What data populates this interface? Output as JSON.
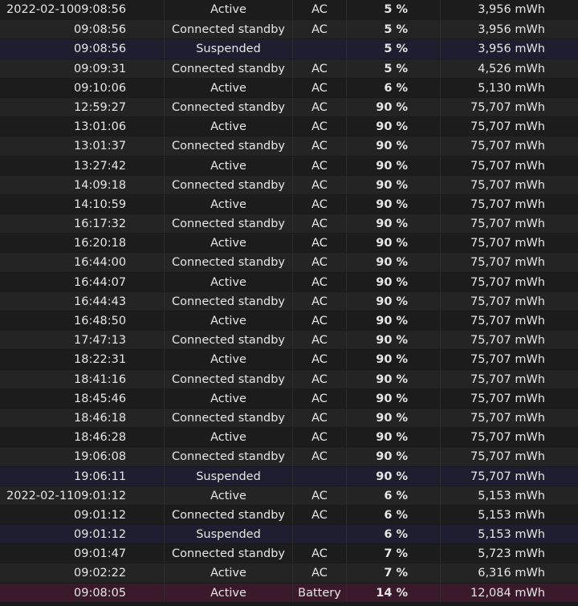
{
  "table": {
    "rows": [
      {
        "date": "2022-02-10",
        "time": "09:08:56",
        "state": "Active",
        "source": "AC",
        "percent": "5 %",
        "capacity": "3,956 mWh",
        "kind": "normal"
      },
      {
        "date": "",
        "time": "09:08:56",
        "state": "Connected standby",
        "source": "AC",
        "percent": "5 %",
        "capacity": "3,956 mWh",
        "kind": "normal"
      },
      {
        "date": "",
        "time": "09:08:56",
        "state": "Suspended",
        "source": "",
        "percent": "5 %",
        "capacity": "3,956 mWh",
        "kind": "suspended"
      },
      {
        "date": "",
        "time": "09:09:31",
        "state": "Connected standby",
        "source": "AC",
        "percent": "5 %",
        "capacity": "4,526 mWh",
        "kind": "normal"
      },
      {
        "date": "",
        "time": "09:10:06",
        "state": "Active",
        "source": "AC",
        "percent": "6 %",
        "capacity": "5,130 mWh",
        "kind": "normal"
      },
      {
        "date": "",
        "time": "12:59:27",
        "state": "Connected standby",
        "source": "AC",
        "percent": "90 %",
        "capacity": "75,707 mWh",
        "kind": "normal"
      },
      {
        "date": "",
        "time": "13:01:06",
        "state": "Active",
        "source": "AC",
        "percent": "90 %",
        "capacity": "75,707 mWh",
        "kind": "normal"
      },
      {
        "date": "",
        "time": "13:01:37",
        "state": "Connected standby",
        "source": "AC",
        "percent": "90 %",
        "capacity": "75,707 mWh",
        "kind": "normal"
      },
      {
        "date": "",
        "time": "13:27:42",
        "state": "Active",
        "source": "AC",
        "percent": "90 %",
        "capacity": "75,707 mWh",
        "kind": "normal"
      },
      {
        "date": "",
        "time": "14:09:18",
        "state": "Connected standby",
        "source": "AC",
        "percent": "90 %",
        "capacity": "75,707 mWh",
        "kind": "normal"
      },
      {
        "date": "",
        "time": "14:10:59",
        "state": "Active",
        "source": "AC",
        "percent": "90 %",
        "capacity": "75,707 mWh",
        "kind": "normal"
      },
      {
        "date": "",
        "time": "16:17:32",
        "state": "Connected standby",
        "source": "AC",
        "percent": "90 %",
        "capacity": "75,707 mWh",
        "kind": "normal"
      },
      {
        "date": "",
        "time": "16:20:18",
        "state": "Active",
        "source": "AC",
        "percent": "90 %",
        "capacity": "75,707 mWh",
        "kind": "normal"
      },
      {
        "date": "",
        "time": "16:44:00",
        "state": "Connected standby",
        "source": "AC",
        "percent": "90 %",
        "capacity": "75,707 mWh",
        "kind": "normal"
      },
      {
        "date": "",
        "time": "16:44:07",
        "state": "Active",
        "source": "AC",
        "percent": "90 %",
        "capacity": "75,707 mWh",
        "kind": "normal"
      },
      {
        "date": "",
        "time": "16:44:43",
        "state": "Connected standby",
        "source": "AC",
        "percent": "90 %",
        "capacity": "75,707 mWh",
        "kind": "normal"
      },
      {
        "date": "",
        "time": "16:48:50",
        "state": "Active",
        "source": "AC",
        "percent": "90 %",
        "capacity": "75,707 mWh",
        "kind": "normal"
      },
      {
        "date": "",
        "time": "17:47:13",
        "state": "Connected standby",
        "source": "AC",
        "percent": "90 %",
        "capacity": "75,707 mWh",
        "kind": "normal"
      },
      {
        "date": "",
        "time": "18:22:31",
        "state": "Active",
        "source": "AC",
        "percent": "90 %",
        "capacity": "75,707 mWh",
        "kind": "normal"
      },
      {
        "date": "",
        "time": "18:41:16",
        "state": "Connected standby",
        "source": "AC",
        "percent": "90 %",
        "capacity": "75,707 mWh",
        "kind": "normal"
      },
      {
        "date": "",
        "time": "18:45:46",
        "state": "Active",
        "source": "AC",
        "percent": "90 %",
        "capacity": "75,707 mWh",
        "kind": "normal"
      },
      {
        "date": "",
        "time": "18:46:18",
        "state": "Connected standby",
        "source": "AC",
        "percent": "90 %",
        "capacity": "75,707 mWh",
        "kind": "normal"
      },
      {
        "date": "",
        "time": "18:46:28",
        "state": "Active",
        "source": "AC",
        "percent": "90 %",
        "capacity": "75,707 mWh",
        "kind": "normal"
      },
      {
        "date": "",
        "time": "19:06:08",
        "state": "Connected standby",
        "source": "AC",
        "percent": "90 %",
        "capacity": "75,707 mWh",
        "kind": "normal"
      },
      {
        "date": "",
        "time": "19:06:11",
        "state": "Suspended",
        "source": "",
        "percent": "90 %",
        "capacity": "75,707 mWh",
        "kind": "suspended"
      },
      {
        "date": "2022-02-11",
        "time": "09:01:12",
        "state": "Active",
        "source": "AC",
        "percent": "6 %",
        "capacity": "5,153 mWh",
        "kind": "normal"
      },
      {
        "date": "",
        "time": "09:01:12",
        "state": "Connected standby",
        "source": "AC",
        "percent": "6 %",
        "capacity": "5,153 mWh",
        "kind": "normal"
      },
      {
        "date": "",
        "time": "09:01:12",
        "state": "Suspended",
        "source": "",
        "percent": "6 %",
        "capacity": "5,153 mWh",
        "kind": "suspended"
      },
      {
        "date": "",
        "time": "09:01:47",
        "state": "Connected standby",
        "source": "AC",
        "percent": "7 %",
        "capacity": "5,723 mWh",
        "kind": "normal"
      },
      {
        "date": "",
        "time": "09:02:22",
        "state": "Active",
        "source": "AC",
        "percent": "7 %",
        "capacity": "6,316 mWh",
        "kind": "normal"
      },
      {
        "date": "",
        "time": "09:08:05",
        "state": "Active",
        "source": "Battery",
        "percent": "14 %",
        "capacity": "12,084 mWh",
        "kind": "battery"
      }
    ]
  },
  "colors": {
    "background": "#1a1a1a",
    "row_odd": "#1c1c1c",
    "row_even": "#242424",
    "suspended_row": "#1e1e30",
    "battery_row": "#3a1a2a",
    "text": "#e6e6e6"
  }
}
